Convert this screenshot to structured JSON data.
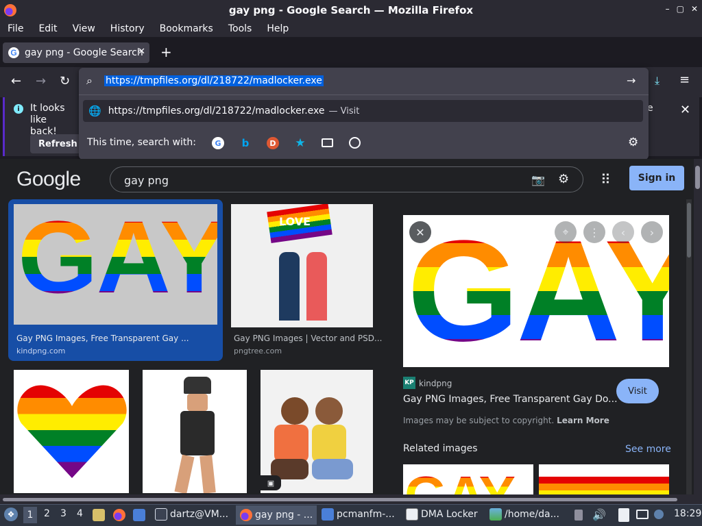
{
  "window": {
    "title": "gay png - Google Search — Mozilla Firefox",
    "controls": [
      "–",
      "▢",
      "✕"
    ]
  },
  "menu": [
    "File",
    "Edit",
    "View",
    "History",
    "Bookmarks",
    "Tools",
    "Help"
  ],
  "tab": {
    "label": "gay png - Google Search",
    "close": "✕"
  },
  "newtab": "+",
  "nav": {
    "back": "←",
    "forward": "→",
    "reload": "↻"
  },
  "urlbar": {
    "value": "https://tmpfiles.org/dl/218722/madlocker.exe",
    "go": "→",
    "suggestion": "https://tmpfiles.org/dl/218722/madlocker.exe",
    "suggestion_action": "— Visit",
    "search_with": "This time, search with:"
  },
  "notification": {
    "text": "It looks like back!",
    "line1": "It looks like",
    "line2": "back!",
    "tail": "e",
    "close": "✕",
    "refresh": "Refresh"
  },
  "google": {
    "logo": "Google",
    "query": "gay png",
    "signin": "Sign in",
    "results": [
      {
        "title": "Gay PNG Images, Free Transparent Gay ...",
        "source": "kindpng.com"
      },
      {
        "title": "Gay PNG Images | Vector and PSD...",
        "source": "pngtree.com"
      }
    ],
    "thumb_text": "GAY",
    "flag_text": "LOVE",
    "preview": {
      "source_name": "kindpng",
      "source_logo": "KP",
      "title": "Gay PNG Images, Free Transparent Gay Do...",
      "visit": "Visit",
      "copyright": "Images may be subject to copyright.",
      "learn_more": "Learn More",
      "related": "Related images",
      "see_more": "See more"
    }
  },
  "taskbar": {
    "workspaces": [
      "1",
      "2",
      "3",
      "4"
    ],
    "items": [
      "dartz@VM...",
      "gay png - ...",
      "pcmanfm-...",
      "DMA Locker",
      "/home/da..."
    ],
    "clock": "18:29"
  },
  "colors": {
    "accent": "#8ab4f8",
    "selected": "#0061e0",
    "selected_card": "#174ea6"
  }
}
